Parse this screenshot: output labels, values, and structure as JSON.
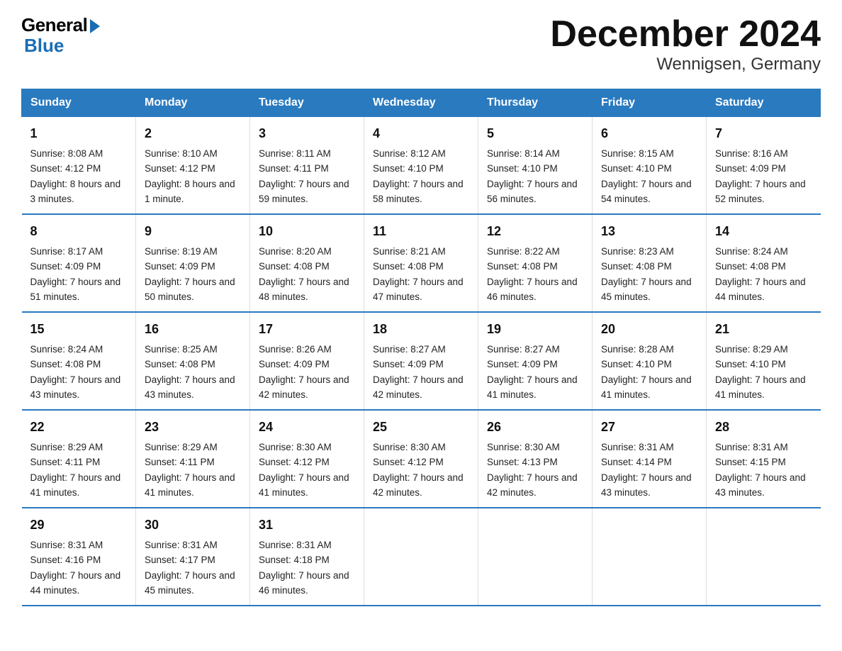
{
  "logo": {
    "general": "General",
    "blue": "Blue"
  },
  "title": "December 2024",
  "subtitle": "Wennigsen, Germany",
  "days_of_week": [
    "Sunday",
    "Monday",
    "Tuesday",
    "Wednesday",
    "Thursday",
    "Friday",
    "Saturday"
  ],
  "weeks": [
    [
      {
        "day": "1",
        "sunrise": "8:08 AM",
        "sunset": "4:12 PM",
        "daylight": "8 hours and 3 minutes."
      },
      {
        "day": "2",
        "sunrise": "8:10 AM",
        "sunset": "4:12 PM",
        "daylight": "8 hours and 1 minute."
      },
      {
        "day": "3",
        "sunrise": "8:11 AM",
        "sunset": "4:11 PM",
        "daylight": "7 hours and 59 minutes."
      },
      {
        "day": "4",
        "sunrise": "8:12 AM",
        "sunset": "4:10 PM",
        "daylight": "7 hours and 58 minutes."
      },
      {
        "day": "5",
        "sunrise": "8:14 AM",
        "sunset": "4:10 PM",
        "daylight": "7 hours and 56 minutes."
      },
      {
        "day": "6",
        "sunrise": "8:15 AM",
        "sunset": "4:10 PM",
        "daylight": "7 hours and 54 minutes."
      },
      {
        "day": "7",
        "sunrise": "8:16 AM",
        "sunset": "4:09 PM",
        "daylight": "7 hours and 52 minutes."
      }
    ],
    [
      {
        "day": "8",
        "sunrise": "8:17 AM",
        "sunset": "4:09 PM",
        "daylight": "7 hours and 51 minutes."
      },
      {
        "day": "9",
        "sunrise": "8:19 AM",
        "sunset": "4:09 PM",
        "daylight": "7 hours and 50 minutes."
      },
      {
        "day": "10",
        "sunrise": "8:20 AM",
        "sunset": "4:08 PM",
        "daylight": "7 hours and 48 minutes."
      },
      {
        "day": "11",
        "sunrise": "8:21 AM",
        "sunset": "4:08 PM",
        "daylight": "7 hours and 47 minutes."
      },
      {
        "day": "12",
        "sunrise": "8:22 AM",
        "sunset": "4:08 PM",
        "daylight": "7 hours and 46 minutes."
      },
      {
        "day": "13",
        "sunrise": "8:23 AM",
        "sunset": "4:08 PM",
        "daylight": "7 hours and 45 minutes."
      },
      {
        "day": "14",
        "sunrise": "8:24 AM",
        "sunset": "4:08 PM",
        "daylight": "7 hours and 44 minutes."
      }
    ],
    [
      {
        "day": "15",
        "sunrise": "8:24 AM",
        "sunset": "4:08 PM",
        "daylight": "7 hours and 43 minutes."
      },
      {
        "day": "16",
        "sunrise": "8:25 AM",
        "sunset": "4:08 PM",
        "daylight": "7 hours and 43 minutes."
      },
      {
        "day": "17",
        "sunrise": "8:26 AM",
        "sunset": "4:09 PM",
        "daylight": "7 hours and 42 minutes."
      },
      {
        "day": "18",
        "sunrise": "8:27 AM",
        "sunset": "4:09 PM",
        "daylight": "7 hours and 42 minutes."
      },
      {
        "day": "19",
        "sunrise": "8:27 AM",
        "sunset": "4:09 PM",
        "daylight": "7 hours and 41 minutes."
      },
      {
        "day": "20",
        "sunrise": "8:28 AM",
        "sunset": "4:10 PM",
        "daylight": "7 hours and 41 minutes."
      },
      {
        "day": "21",
        "sunrise": "8:29 AM",
        "sunset": "4:10 PM",
        "daylight": "7 hours and 41 minutes."
      }
    ],
    [
      {
        "day": "22",
        "sunrise": "8:29 AM",
        "sunset": "4:11 PM",
        "daylight": "7 hours and 41 minutes."
      },
      {
        "day": "23",
        "sunrise": "8:29 AM",
        "sunset": "4:11 PM",
        "daylight": "7 hours and 41 minutes."
      },
      {
        "day": "24",
        "sunrise": "8:30 AM",
        "sunset": "4:12 PM",
        "daylight": "7 hours and 41 minutes."
      },
      {
        "day": "25",
        "sunrise": "8:30 AM",
        "sunset": "4:12 PM",
        "daylight": "7 hours and 42 minutes."
      },
      {
        "day": "26",
        "sunrise": "8:30 AM",
        "sunset": "4:13 PM",
        "daylight": "7 hours and 42 minutes."
      },
      {
        "day": "27",
        "sunrise": "8:31 AM",
        "sunset": "4:14 PM",
        "daylight": "7 hours and 43 minutes."
      },
      {
        "day": "28",
        "sunrise": "8:31 AM",
        "sunset": "4:15 PM",
        "daylight": "7 hours and 43 minutes."
      }
    ],
    [
      {
        "day": "29",
        "sunrise": "8:31 AM",
        "sunset": "4:16 PM",
        "daylight": "7 hours and 44 minutes."
      },
      {
        "day": "30",
        "sunrise": "8:31 AM",
        "sunset": "4:17 PM",
        "daylight": "7 hours and 45 minutes."
      },
      {
        "day": "31",
        "sunrise": "8:31 AM",
        "sunset": "4:18 PM",
        "daylight": "7 hours and 46 minutes."
      },
      null,
      null,
      null,
      null
    ]
  ],
  "labels": {
    "sunrise": "Sunrise: ",
    "sunset": "Sunset: ",
    "daylight": "Daylight: "
  }
}
